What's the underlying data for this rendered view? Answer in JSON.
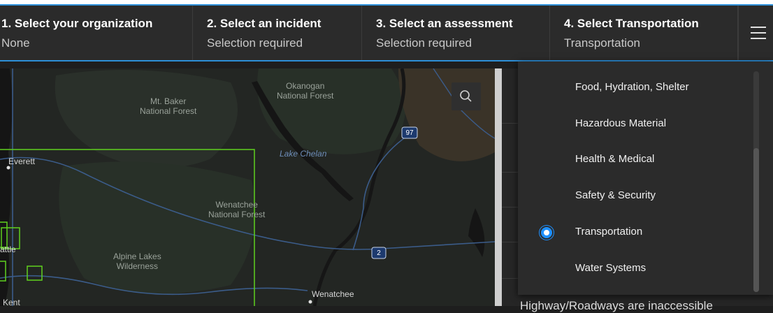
{
  "steps": [
    {
      "title": "1. Select your organization",
      "subtitle": "None"
    },
    {
      "title": "2. Select an incident",
      "subtitle": "Selection required"
    },
    {
      "title": "3. Select an assessment",
      "subtitle": "Selection required"
    },
    {
      "title": "4. Select Transportation",
      "subtitle": "Transportation"
    }
  ],
  "menu_icon": "hamburger-icon",
  "map": {
    "search_icon": "search-icon",
    "labels": {
      "okanogan": "Okanogan\nNational Forest",
      "mt_baker": "Mt. Baker\nNational Forest",
      "lake_chelan": "Lake Chelan",
      "everett": "Everett",
      "wenatchee_nf": "Wenatchee\nNational Forest",
      "alpine_lakes": "Alpine Lakes\nWilderness",
      "seattle": "attle",
      "wenatchee": "Wenatchee",
      "kent": "Kent",
      "hwy_97": "97",
      "hwy_2": "2"
    }
  },
  "dropdown": {
    "items": [
      {
        "label": "Food, Hydration, Shelter",
        "selected": false
      },
      {
        "label": "Hazardous Material",
        "selected": false
      },
      {
        "label": "Health & Medical",
        "selected": false
      },
      {
        "label": "Safety & Security",
        "selected": false
      },
      {
        "label": "Transportation",
        "selected": true
      },
      {
        "label": "Water Systems",
        "selected": false
      }
    ]
  },
  "side_panel": {
    "bottom_text": "Highway/Roadways are inaccessible"
  },
  "colors": {
    "accent": "#2d8fd8",
    "boundary": "#5fd11e",
    "radio": "#1e90ff"
  }
}
